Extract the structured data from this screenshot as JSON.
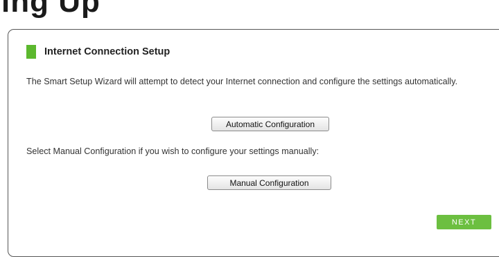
{
  "page": {
    "title_fragment": "ing Up"
  },
  "section": {
    "title": "Internet Connection Setup",
    "accent_color": "#5cb82e"
  },
  "wizard": {
    "intro_text": "The Smart Setup Wizard will attempt to detect your Internet connection and configure the settings automatically.",
    "auto_button_label": "Automatic Configuration",
    "manual_text": "Select Manual Configuration if you wish to configure your settings manually:",
    "manual_button_label": "Manual Configuration",
    "next_button_label": "NEXT",
    "next_button_color": "#6cbf40"
  }
}
